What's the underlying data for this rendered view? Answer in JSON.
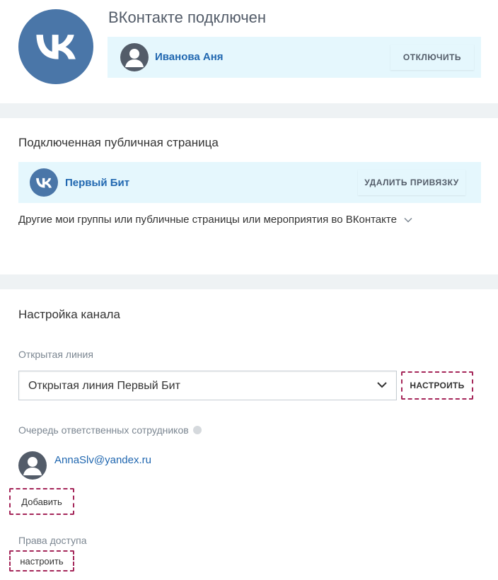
{
  "colors": {
    "vk_blue": "#4a76a8",
    "link_blue": "#2067b0",
    "light_blue_bar": "#e5f7fd",
    "divider_gray": "#eef2f4",
    "highlight_dashed": "#a5275a"
  },
  "header": {
    "logo_icon": "vk-logo-icon",
    "title": "ВКонтакте подключен",
    "account": {
      "avatar_icon": "user-avatar-icon",
      "name": "Иванова Аня",
      "disconnect_label": "ОТКЛЮЧИТЬ"
    }
  },
  "public_page": {
    "title": "Подключенная публичная страница",
    "page": {
      "logo_icon": "vk-logo-icon",
      "name": "Первый Бит",
      "unbind_label": "УДАЛИТЬ ПРИВЯЗКУ"
    },
    "other_groups_label": "Другие мои группы или публичные страницы или мероприятия во ВКонтакте",
    "other_groups_icon": "chevron-down-icon"
  },
  "channel_settings": {
    "title": "Настройка канала",
    "open_line_label": "Открытая линия",
    "open_line_value": "Открытая линия Первый Бит",
    "setup_label": "НАСТРОИТЬ",
    "queue_label": "Очередь ответственных сотрудников",
    "queue_help_icon": "help-icon",
    "queue_users": [
      {
        "email": "AnnaSlv@yandex.ru",
        "avatar_icon": "user-avatar-icon"
      }
    ],
    "add_label": "Добавить",
    "access_label": "Права доступа",
    "access_setup_label": "настроить"
  }
}
